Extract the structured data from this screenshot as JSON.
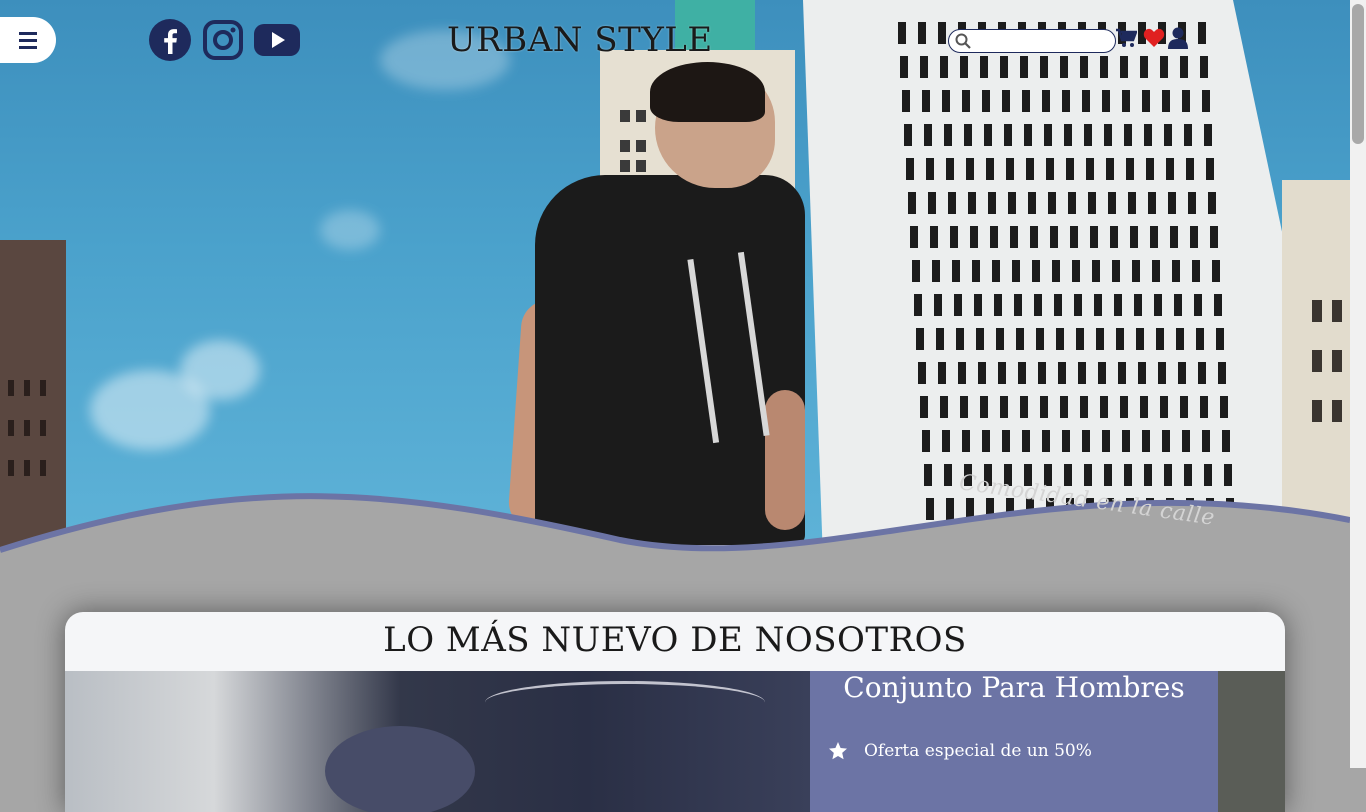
{
  "header": {
    "menu_label": "menu",
    "brand": "URBAN STYLE",
    "search": {
      "placeholder": "",
      "value": ""
    },
    "social": [
      "facebook-icon",
      "instagram-icon",
      "youtube-icon"
    ],
    "icons": [
      "cart-icon",
      "heart-icon",
      "user-icon"
    ]
  },
  "hero": {
    "tagline": "Comodidad en la calle"
  },
  "section": {
    "title": "LO MÁS NUEVO DE NOSOTROS",
    "product": {
      "name": "Conjunto Para Hombres",
      "offer": "Oferta especial de un 50%"
    }
  },
  "colors": {
    "navy": "#1e2a5c",
    "wave": "#6c74a5",
    "background": "#a6a6a6",
    "heart": "#e02020"
  }
}
